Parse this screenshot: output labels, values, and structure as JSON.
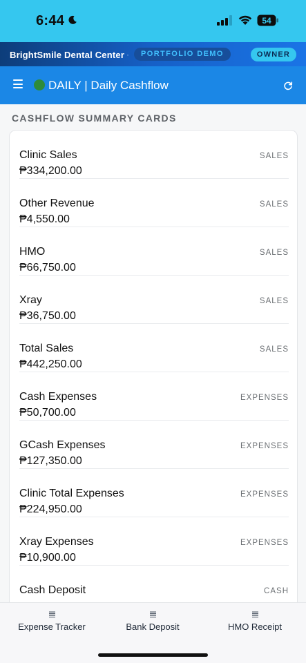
{
  "status_bar": {
    "time": "6:44",
    "battery": "54"
  },
  "brand": {
    "name": "BrightSmile Dental Center",
    "separator": "·",
    "demo_badge": "PORTFOLIO DEMO",
    "role_badge": "OWNER"
  },
  "header": {
    "title": "DAILY | Daily Cashflow"
  },
  "section": {
    "title": "CASHFLOW SUMMARY CARDS"
  },
  "cards": [
    {
      "label": "Clinic Sales",
      "amount": "₱334,200.00",
      "category": "SALES"
    },
    {
      "label": "Other Revenue",
      "amount": "₱4,550.00",
      "category": "SALES"
    },
    {
      "label": "HMO",
      "amount": "₱66,750.00",
      "category": "SALES"
    },
    {
      "label": "Xray",
      "amount": "₱36,750.00",
      "category": "SALES"
    },
    {
      "label": "Total Sales",
      "amount": "₱442,250.00",
      "category": "SALES"
    },
    {
      "label": "Cash Expenses",
      "amount": "₱50,700.00",
      "category": "EXPENSES"
    },
    {
      "label": "GCash Expenses",
      "amount": "₱127,350.00",
      "category": "EXPENSES"
    },
    {
      "label": "Clinic Total Expenses",
      "amount": "₱224,950.00",
      "category": "EXPENSES"
    },
    {
      "label": "Xray Expenses",
      "amount": "₱10,900.00",
      "category": "EXPENSES"
    },
    {
      "label": "Cash Deposit",
      "amount": "",
      "category": "CASH"
    }
  ],
  "bottom_nav": [
    {
      "label": "Expense Tracker",
      "icon": "list-icon"
    },
    {
      "label": "Bank Deposit",
      "icon": "list-icon"
    },
    {
      "label": "HMO Receipt",
      "icon": "list-icon"
    }
  ]
}
